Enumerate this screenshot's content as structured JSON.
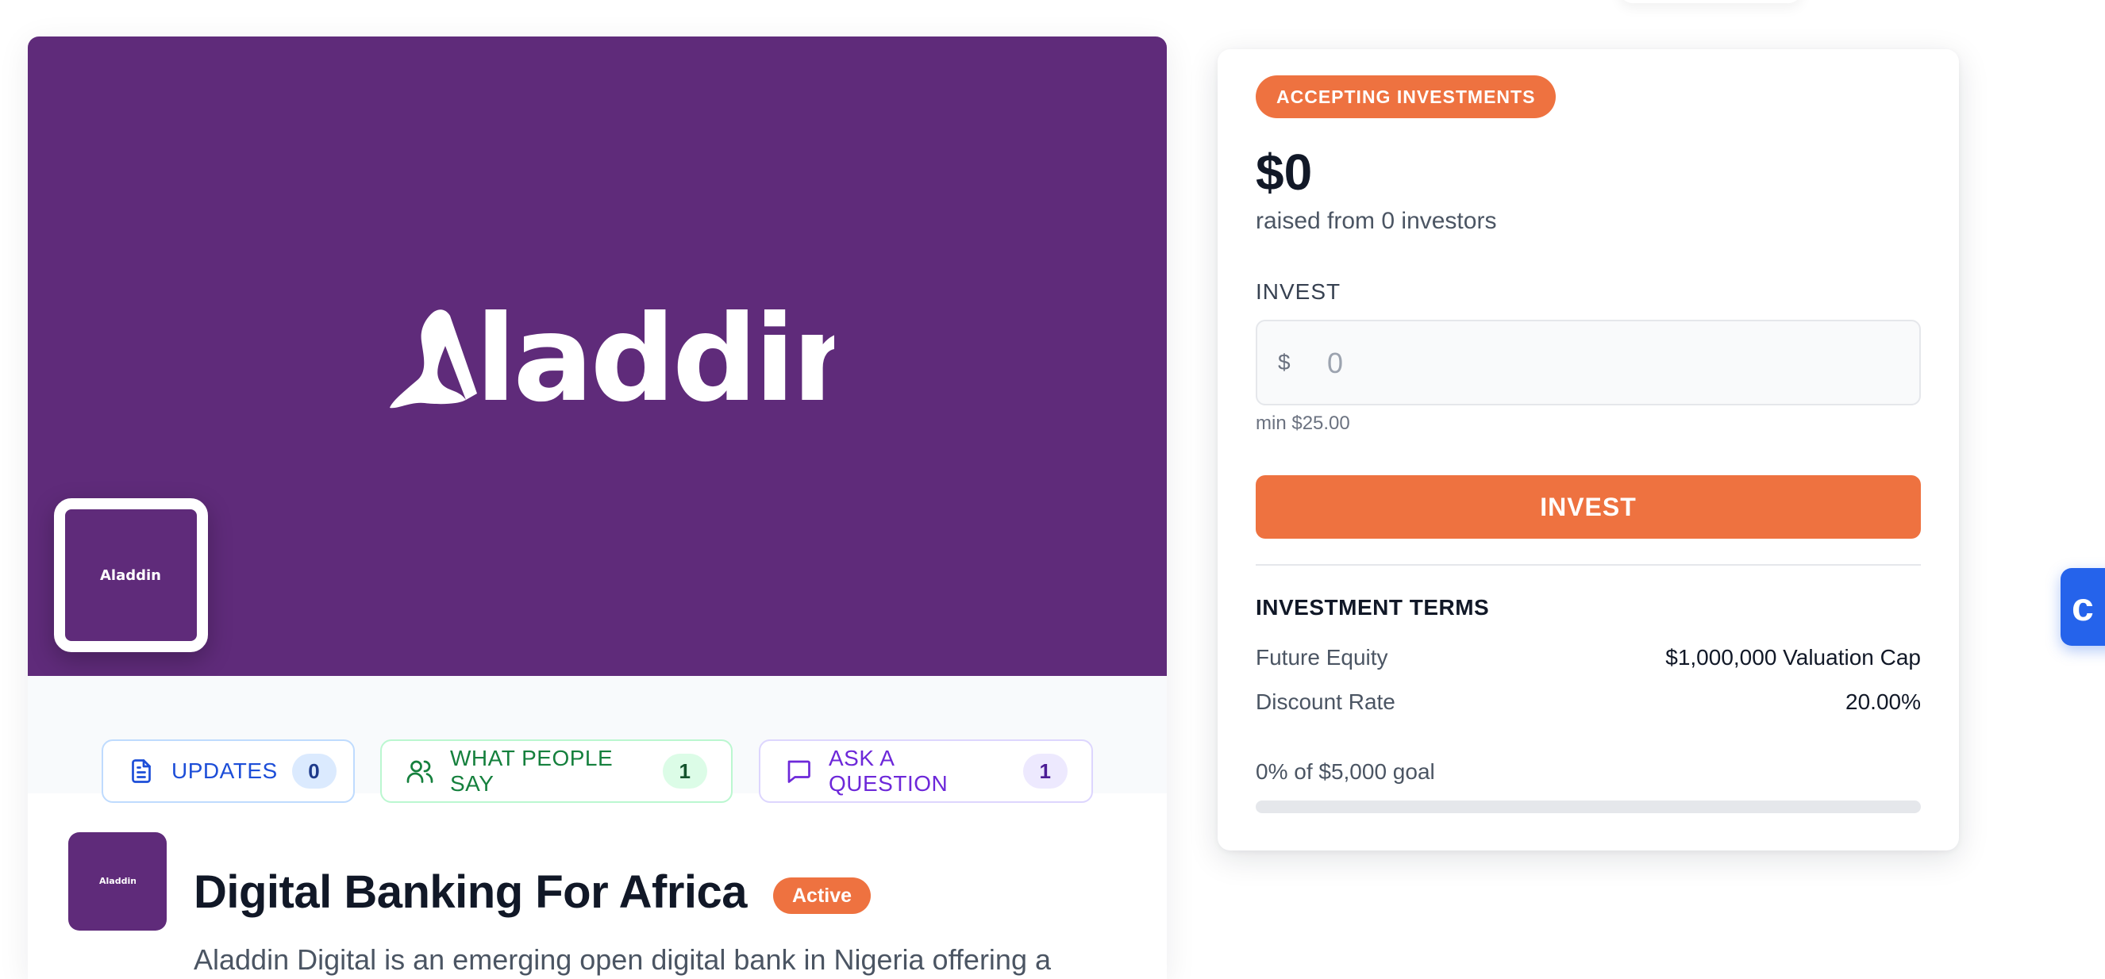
{
  "brand": {
    "logo_text": "Aladdin",
    "primary_color": "#5f2b7a",
    "accent_color": "#ee7240"
  },
  "tabs": [
    {
      "label": "UPDATES",
      "count": "0",
      "icon": "document-icon",
      "color": "#1d4ed8"
    },
    {
      "label": "WHAT PEOPLE SAY",
      "count": "1",
      "icon": "users-icon",
      "color": "#15803d"
    },
    {
      "label": "ASK A QUESTION",
      "count": "1",
      "icon": "chat-bubble-icon",
      "color": "#6d28d9"
    }
  ],
  "company": {
    "name": "Digital Banking For Africa",
    "status": "Active",
    "description": "Aladdin Digital is an emerging open digital bank in Nigeria offering a broad financial toolkit"
  },
  "investment": {
    "badge": "ACCEPTING INVESTMENTS",
    "raised_amount": "$0",
    "raised_subtitle": "raised from 0 investors",
    "invest_label": "INVEST",
    "currency_symbol": "$",
    "amount_placeholder": "0",
    "min_note": "min $25.00",
    "button_label": "INVEST",
    "terms_title": "INVESTMENT TERMS",
    "terms": [
      {
        "label": "Future Equity",
        "value": "$1,000,000 Valuation Cap"
      },
      {
        "label": "Discount Rate",
        "value": "20.00%"
      }
    ],
    "goal_text": "0% of $5,000 goal",
    "goal_progress_percent": 0
  },
  "chat_widget": {
    "label": "c"
  }
}
